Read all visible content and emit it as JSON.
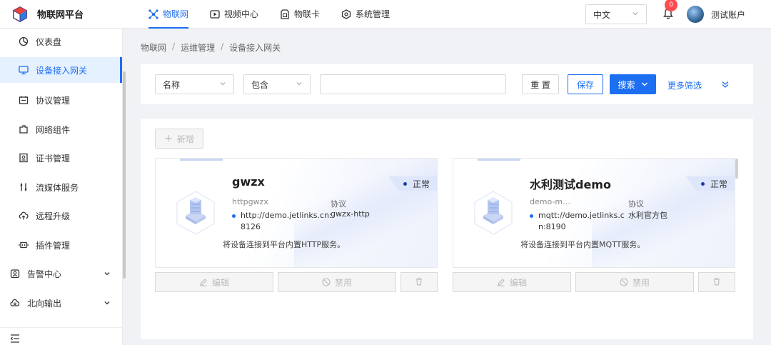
{
  "header": {
    "logo_text": "物联网平台",
    "nav": [
      {
        "label": "物联网",
        "icon": "iot-icon",
        "active": true
      },
      {
        "label": "视频中心",
        "icon": "video-icon",
        "active": false
      },
      {
        "label": "物联卡",
        "icon": "sim-card-icon",
        "active": false
      },
      {
        "label": "系统管理",
        "icon": "system-icon",
        "active": false
      }
    ],
    "language": "中文",
    "notification_count": "0",
    "username": "测试账户"
  },
  "sidebar": {
    "items": [
      {
        "label": "仪表盘",
        "icon": "dashboard-icon"
      },
      {
        "label": "设备接入网关",
        "icon": "monitor-icon",
        "active": true
      },
      {
        "label": "协议管理",
        "icon": "protocol-icon"
      },
      {
        "label": "网络组件",
        "icon": "network-component-icon"
      },
      {
        "label": "证书管理",
        "icon": "certificate-icon"
      },
      {
        "label": "流媒体服务",
        "icon": "stream-icon"
      },
      {
        "label": "远程升级",
        "icon": "cloud-upload-icon"
      },
      {
        "label": "插件管理",
        "icon": "plugin-icon"
      }
    ],
    "groups": [
      {
        "label": "告警中心",
        "icon": "alarm-icon"
      },
      {
        "label": "北向输出",
        "icon": "cloud-output-icon"
      }
    ]
  },
  "breadcrumb": [
    "物联网",
    "运维管理",
    "设备接入网关"
  ],
  "filter": {
    "field": "名称",
    "operator": "包含",
    "value": "",
    "reset_label": "重 置",
    "save_label": "保存",
    "search_label": "搜索",
    "more_label": "更多筛选"
  },
  "add_label": "新增",
  "cards": [
    {
      "title": "gwzx",
      "status": "正常",
      "subtitle": "httpgwzx",
      "url": "http://demo.jetlinks.cn:8126",
      "protocol_label": "协议",
      "protocol": "gwzx-http",
      "description": "将设备连接到平台内置HTTP服务。",
      "edit_label": "编辑",
      "disable_label": "禁用"
    },
    {
      "title": "水利测试demo",
      "status": "正常",
      "subtitle": "demo-m…",
      "url": "mqtt://demo.jetlinks.cn:8190",
      "protocol_label": "协议",
      "protocol": "水利官方包",
      "description": "将设备连接到平台内置MQTT服务。",
      "edit_label": "编辑",
      "disable_label": "禁用"
    }
  ],
  "colors": {
    "primary": "#1d6ff2",
    "badge": "#ff4d4f"
  }
}
